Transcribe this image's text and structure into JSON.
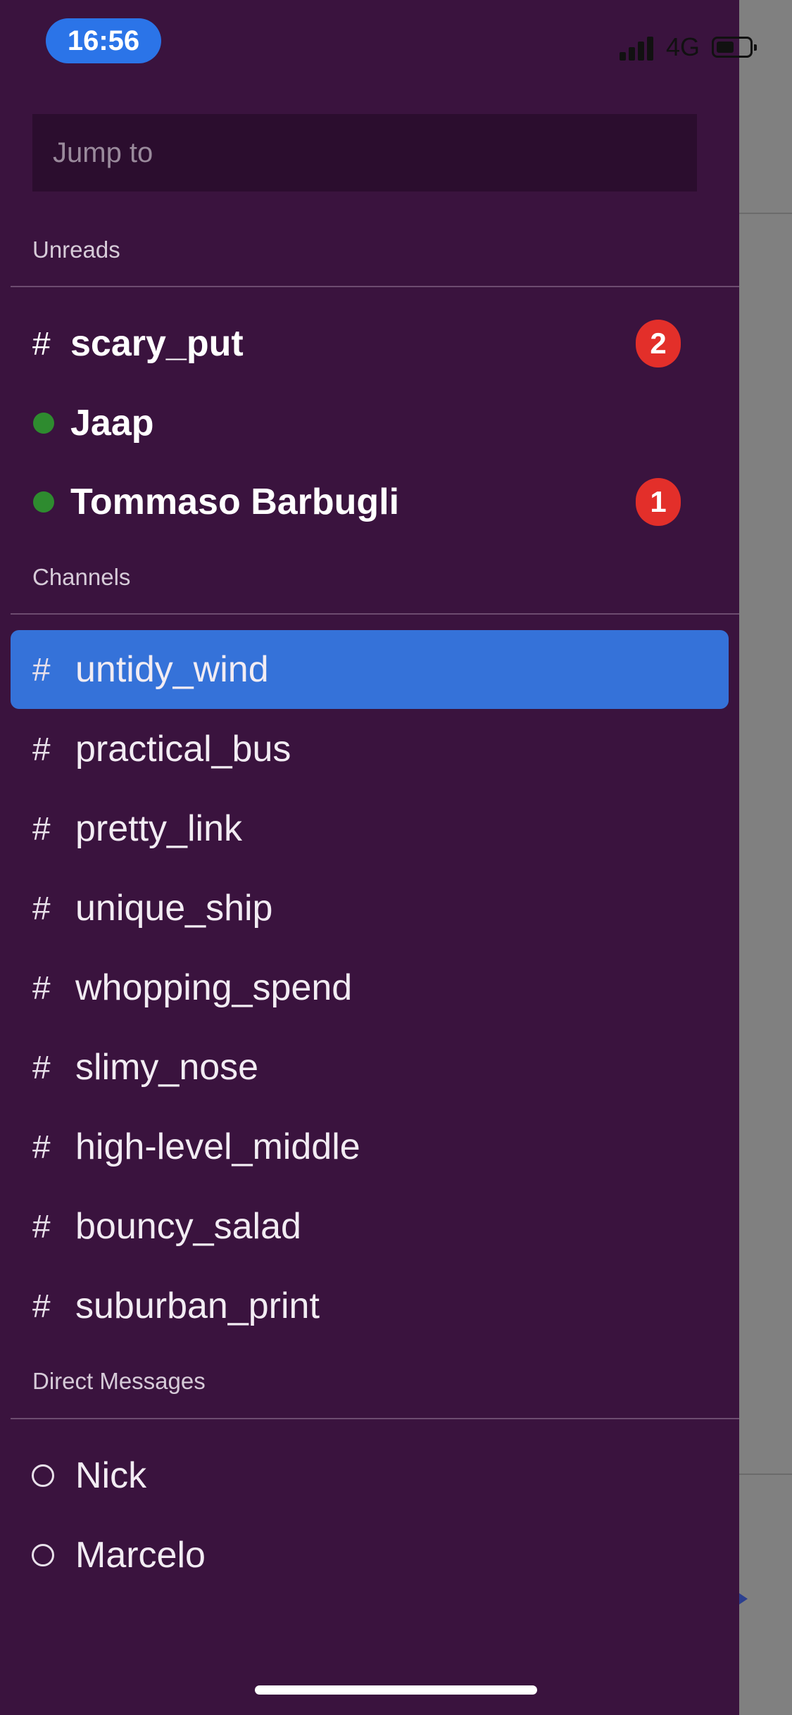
{
  "status_bar": {
    "time": "16:56",
    "network": "4G"
  },
  "search": {
    "placeholder": "Jump to"
  },
  "unreads": {
    "heading": "Unreads",
    "items": [
      {
        "kind": "channel",
        "prefix": "#",
        "name": "scary_put",
        "badge": "2"
      },
      {
        "kind": "dm",
        "name": "Jaap",
        "presence": "online"
      },
      {
        "kind": "dm",
        "name": "Tommaso Barbugli",
        "presence": "online",
        "badge": "1"
      }
    ]
  },
  "channels": {
    "heading": "Channels",
    "selected": "untidy_wind",
    "items": [
      {
        "prefix": "#",
        "name": "untidy_wind"
      },
      {
        "prefix": "#",
        "name": "practical_bus"
      },
      {
        "prefix": "#",
        "name": "pretty_link"
      },
      {
        "prefix": "#",
        "name": "unique_ship"
      },
      {
        "prefix": "#",
        "name": "whopping_spend"
      },
      {
        "prefix": "#",
        "name": "slimy_nose"
      },
      {
        "prefix": "#",
        "name": "high-level_middle"
      },
      {
        "prefix": "#",
        "name": "bouncy_salad"
      },
      {
        "prefix": "#",
        "name": "suburban_print"
      }
    ]
  },
  "direct_messages": {
    "heading": "Direct Messages",
    "items": [
      {
        "name": "Nick",
        "presence": "offline"
      },
      {
        "name": "Marcelo",
        "presence": "offline"
      }
    ]
  },
  "colors": {
    "drawer_bg": "#3a133e",
    "search_bg": "#2b0d2e",
    "selected_bg": "#3572d9",
    "badge_red": "#e32f2a",
    "online_green": "#2e8b2f",
    "time_pill": "#2b74e8",
    "backdrop": "#808080"
  }
}
